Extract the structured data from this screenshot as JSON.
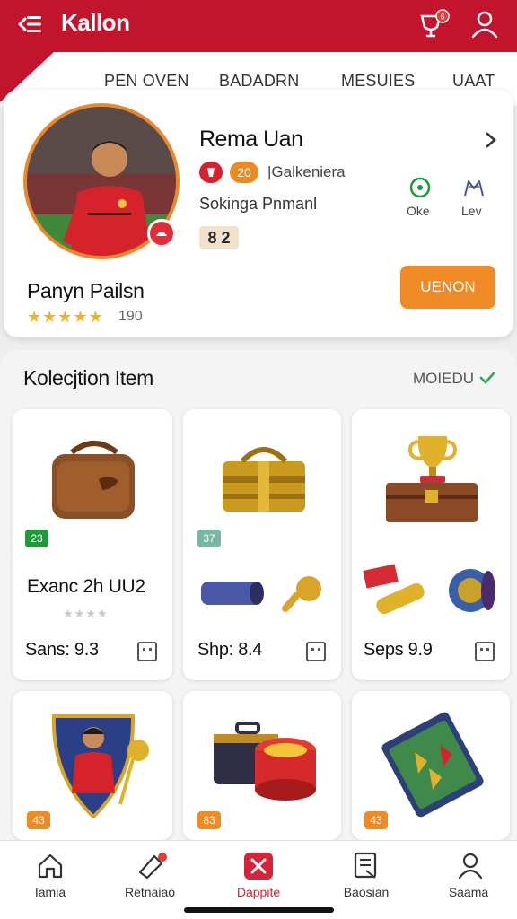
{
  "header": {
    "title": "Kallon",
    "notification_badge": "6"
  },
  "tabs": [
    "PEN OVEN",
    "BADADRN",
    "MESUIES",
    "UAAT"
  ],
  "profile": {
    "name": "Rema Uan",
    "badge_number": "20",
    "club": "|Galkeniera",
    "position": "Sokinga Pnmanl",
    "rating": "8 2",
    "stats": [
      {
        "label": "Oke",
        "icon": "ok-icon"
      },
      {
        "label": "Lev",
        "icon": "lev-icon"
      }
    ],
    "action_button": "UENON",
    "player_name": "Panyn Pailsn",
    "stars": "★★★★★",
    "star_count": "190",
    "colors": {
      "brand": "#c3142d",
      "accent": "#ef8a24",
      "star": "#f0b028"
    }
  },
  "section": {
    "title": "Kolecjtion Item",
    "link": "MOIEDU"
  },
  "cards": [
    {
      "tag": "23",
      "tag_color": "#1f9a3b",
      "title": "Exanc 2h UU2",
      "stars": "★★★★",
      "price": "Sans: 9.3",
      "item": "leather-bag"
    },
    {
      "tag": "37",
      "tag_color": "#78b7a3",
      "title": "",
      "stars": "",
      "price": "Shp: 8.4",
      "item": "golden-chest"
    },
    {
      "tag": "",
      "tag_color": "",
      "title": "",
      "stars": "",
      "price": "Seps 9.9",
      "item": "trophy-chest"
    },
    {
      "tag": "43",
      "tag_color": "#f08a24",
      "title": "",
      "stars": "",
      "price": "",
      "item": "player-shield"
    },
    {
      "tag": "83",
      "tag_color": "#f08a24",
      "title": "",
      "stars": "",
      "price": "",
      "item": "drum-case"
    },
    {
      "tag": "43",
      "tag_color": "#f08a24",
      "title": "",
      "stars": "",
      "price": "",
      "item": "card-stack"
    }
  ],
  "nav": [
    {
      "label": "Iamia",
      "icon": "home-icon"
    },
    {
      "label": "Retnaiao",
      "icon": "tag-icon"
    },
    {
      "label": "Dappite",
      "icon": "favorites-icon"
    },
    {
      "label": "Baosian",
      "icon": "document-icon"
    },
    {
      "label": "Saama",
      "icon": "profile-icon"
    }
  ]
}
